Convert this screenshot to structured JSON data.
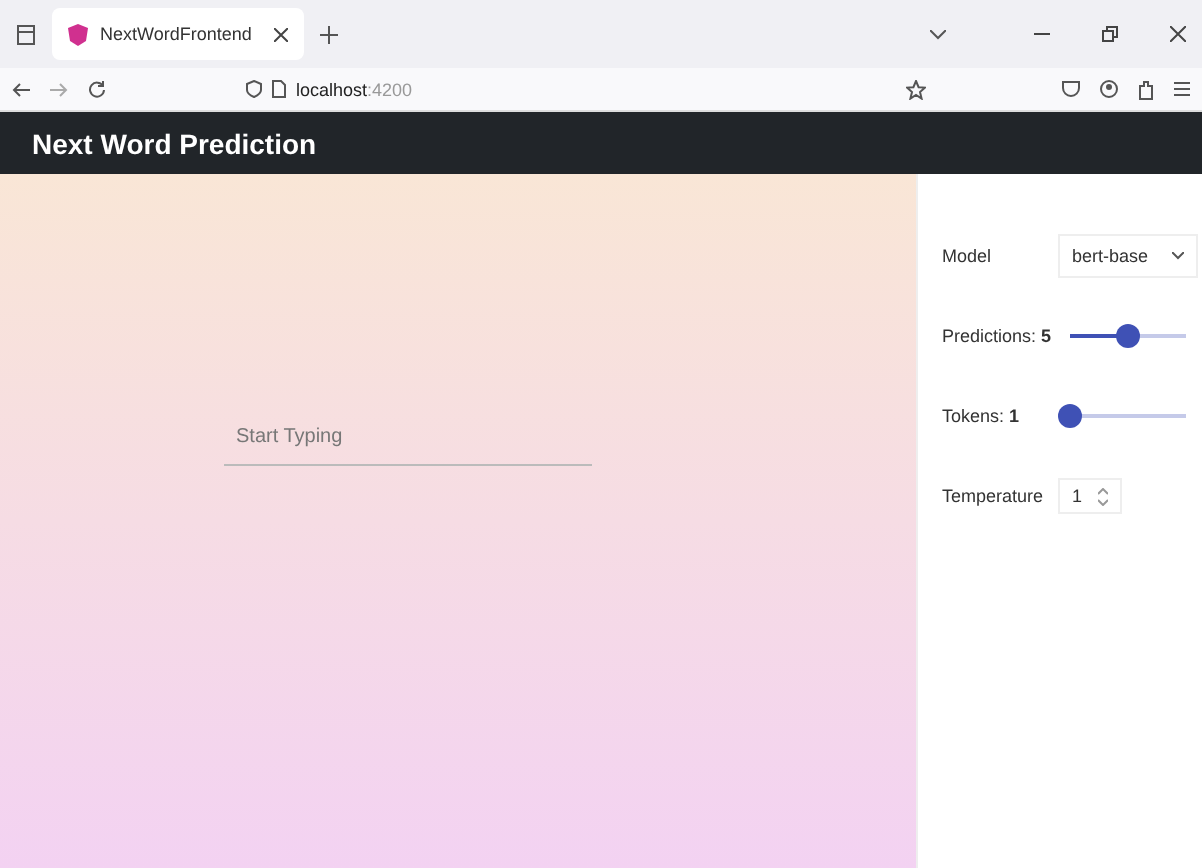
{
  "browser": {
    "tab_title": "NextWordFrontend",
    "url_host": "localhost",
    "url_port": ":4200"
  },
  "app_bar": {
    "title": "Next Word Prediction"
  },
  "input": {
    "placeholder": "Start Typing"
  },
  "settings": [
    {
      "kind": "select",
      "label": "Model",
      "value": "bert-base"
    },
    {
      "kind": "slider",
      "label": "Predictions: **5**",
      "level": 0.5
    },
    {
      "kind": "slider",
      "label": "Tokens: **1**",
      "level": 0
    },
    {
      "kind": "number",
      "label": "Temperature",
      "value": "1"
    }
  ]
}
